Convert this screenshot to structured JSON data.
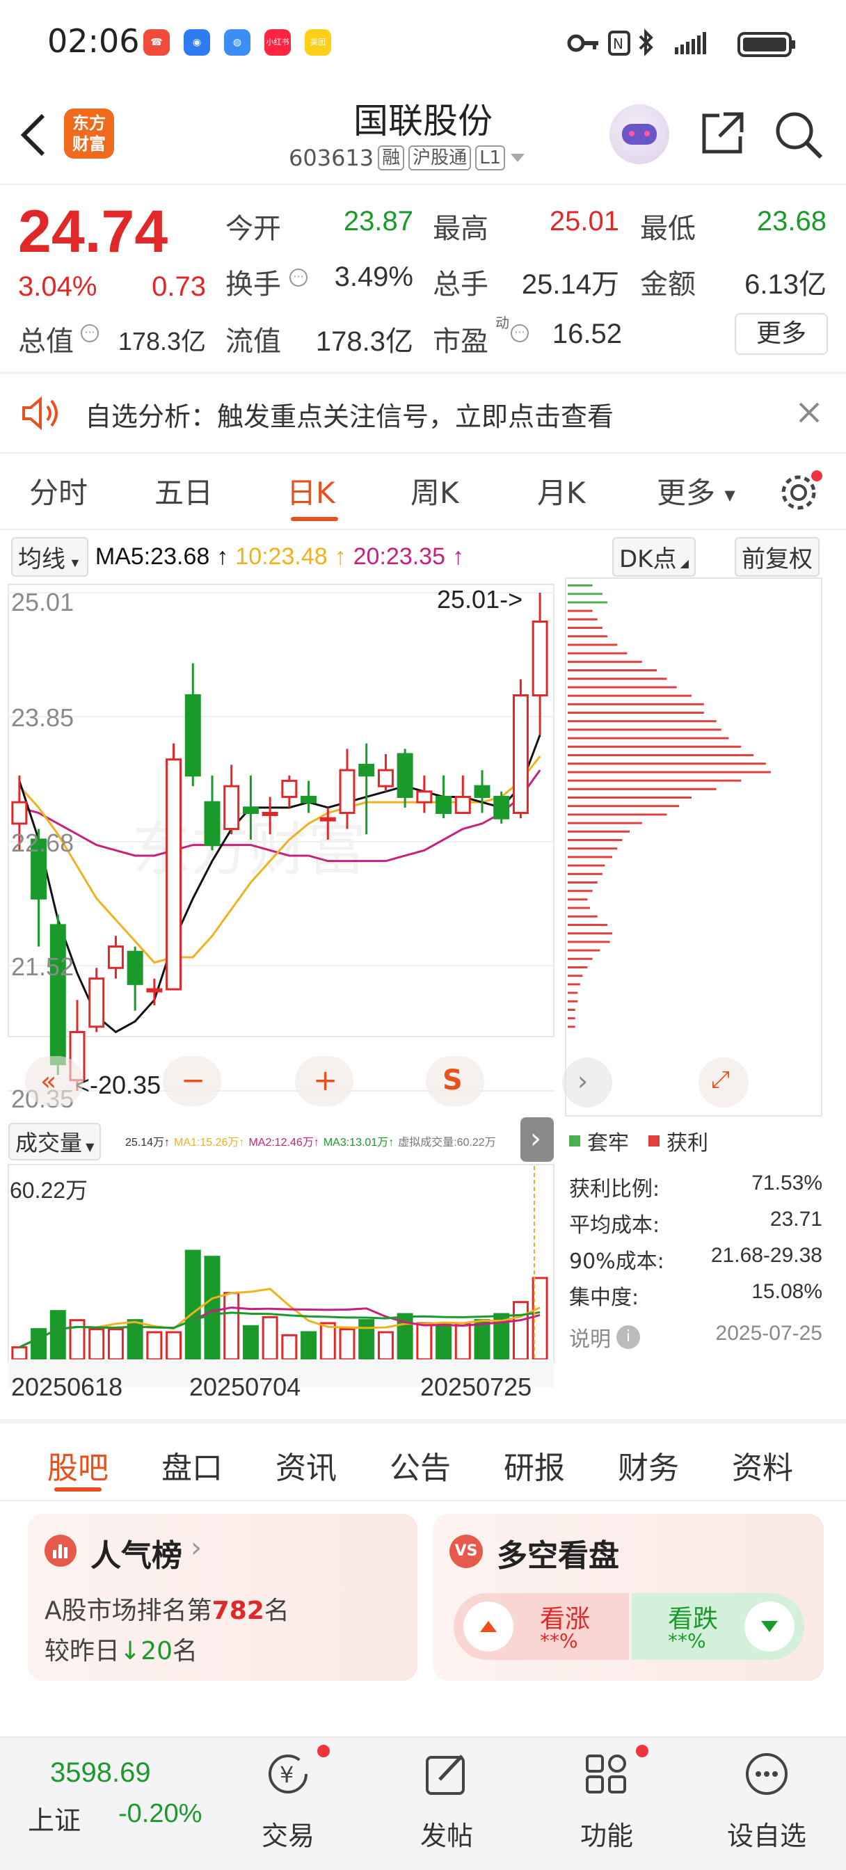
{
  "status_bar": {
    "time": "02:06",
    "apps": [
      {
        "name": "phone-app",
        "color": "#f04a3a",
        "label": "☎"
      },
      {
        "name": "browser-app",
        "color": "#2f7cf2",
        "label": "◉"
      },
      {
        "name": "globe-app",
        "color": "#3c8df5",
        "label": "◍"
      },
      {
        "name": "xiaohongshu-app",
        "color": "#ff2442",
        "label": "小红书"
      },
      {
        "name": "meituan-app",
        "color": "#ffcf1a",
        "label": "美团"
      }
    ],
    "battery_icon": "battery-icon"
  },
  "nav": {
    "logo_line1": "东方",
    "logo_line2": "财富",
    "stock_name": "国联股份",
    "stock_code": "603613",
    "tag_margin": "融",
    "tag_connect": "沪股通",
    "tag_level": "L1"
  },
  "quote": {
    "price": "24.74",
    "change_pct": "3.04%",
    "change_amt": "0.73",
    "open_label": "今开",
    "open": "23.87",
    "high_label": "最高",
    "high": "25.01",
    "low_label": "最低",
    "low": "23.68",
    "turnover_label": "换手",
    "turnover": "3.49%",
    "volume_label": "总手",
    "volume": "25.14万",
    "amount_label": "金额",
    "amount": "6.13亿",
    "mktcap_label": "总值",
    "mktcap": "178.3亿",
    "float_label": "流值",
    "float": "178.3亿",
    "pe_label": "市盈",
    "pe_sup": "动",
    "pe": "16.52",
    "more_button": "更多"
  },
  "alert": {
    "text": "自选分析：触发重点关注信号，立即点击查看"
  },
  "kline_tabs": [
    "分时",
    "五日",
    "日K",
    "周K",
    "月K",
    "更多"
  ],
  "kline_active": "日K",
  "ma_row": {
    "select_label": "均线",
    "ma5": "MA5:23.68",
    "ma10": "10:23.48",
    "ma20": "20:23.35",
    "dk_button": "DK点",
    "adjust_button": "前复权",
    "colors": {
      "ma5": "#111111",
      "ma10": "#f0b21c",
      "ma20": "#c8207c"
    }
  },
  "chart_data": {
    "type": "candlestick",
    "y_ticks": [
      "25.01",
      "23.85",
      "22.68",
      "21.52",
      "20.35"
    ],
    "ylim": [
      20.35,
      25.01
    ],
    "max_label": "25.01->",
    "min_label": "<-20.35",
    "x_labels": [
      "20250618",
      "20250704",
      "20250725"
    ],
    "watermark": "东方财富",
    "candles": [
      {
        "o": 22.85,
        "c": 23.05,
        "h": 23.3,
        "l": 22.6
      },
      {
        "o": 22.7,
        "c": 22.15,
        "h": 22.8,
        "l": 21.7
      },
      {
        "o": 21.9,
        "c": 20.6,
        "h": 22.0,
        "l": 20.5
      },
      {
        "o": 20.45,
        "c": 20.9,
        "h": 21.2,
        "l": 20.35
      },
      {
        "o": 20.95,
        "c": 21.4,
        "h": 21.5,
        "l": 20.9
      },
      {
        "o": 21.5,
        "c": 21.7,
        "h": 21.8,
        "l": 21.4
      },
      {
        "o": 21.65,
        "c": 21.35,
        "h": 21.7,
        "l": 21.1
      },
      {
        "o": 21.3,
        "c": 21.3,
        "h": 21.4,
        "l": 21.15
      },
      {
        "o": 21.3,
        "c": 23.45,
        "h": 23.6,
        "l": 21.3
      },
      {
        "o": 24.05,
        "c": 23.3,
        "h": 24.35,
        "l": 23.2
      },
      {
        "o": 23.05,
        "c": 22.65,
        "h": 23.3,
        "l": 22.6
      },
      {
        "o": 22.8,
        "c": 23.2,
        "h": 23.4,
        "l": 22.75
      },
      {
        "o": 23.0,
        "c": 22.95,
        "h": 23.3,
        "l": 22.7
      },
      {
        "o": 22.95,
        "c": 22.95,
        "h": 23.1,
        "l": 22.75
      },
      {
        "o": 23.1,
        "c": 23.25,
        "h": 23.3,
        "l": 23.0
      },
      {
        "o": 23.1,
        "c": 23.05,
        "h": 23.25,
        "l": 22.95
      },
      {
        "o": 22.9,
        "c": 22.9,
        "h": 23.0,
        "l": 22.7
      },
      {
        "o": 22.95,
        "c": 23.35,
        "h": 23.55,
        "l": 22.8
      },
      {
        "o": 23.4,
        "c": 23.3,
        "h": 23.6,
        "l": 22.75
      },
      {
        "o": 23.2,
        "c": 23.35,
        "h": 23.5,
        "l": 23.15
      },
      {
        "o": 23.5,
        "c": 23.1,
        "h": 23.55,
        "l": 23.0
      },
      {
        "o": 23.05,
        "c": 23.15,
        "h": 23.3,
        "l": 22.95
      },
      {
        "o": 23.1,
        "c": 22.95,
        "h": 23.3,
        "l": 22.9
      },
      {
        "o": 22.95,
        "c": 23.1,
        "h": 23.3,
        "l": 22.95
      },
      {
        "o": 23.2,
        "c": 23.1,
        "h": 23.35,
        "l": 22.95
      },
      {
        "o": 23.1,
        "c": 22.9,
        "h": 23.15,
        "l": 22.85
      },
      {
        "o": 22.95,
        "c": 24.05,
        "h": 24.2,
        "l": 22.9
      },
      {
        "o": 24.05,
        "c": 24.74,
        "h": 25.01,
        "l": 23.68
      }
    ],
    "ma5": [
      23.25,
      22.7,
      21.95,
      21.45,
      21.05,
      20.9,
      21.0,
      21.2,
      21.75,
      22.15,
      22.5,
      22.8,
      23.0,
      23.0,
      23.0,
      23.05,
      23.0,
      23.05,
      23.1,
      23.15,
      23.2,
      23.15,
      23.1,
      23.1,
      23.05,
      23.0,
      23.2,
      23.68
    ],
    "ma10": [
      23.2,
      23.0,
      22.75,
      22.45,
      22.15,
      21.95,
      21.75,
      21.55,
      21.6,
      21.6,
      21.8,
      22.05,
      22.3,
      22.5,
      22.7,
      22.85,
      22.95,
      23.0,
      23.05,
      23.05,
      23.05,
      23.05,
      23.05,
      23.05,
      23.05,
      23.1,
      23.25,
      23.48
    ],
    "ma20": [
      23.0,
      22.95,
      22.85,
      22.75,
      22.65,
      22.6,
      22.55,
      22.55,
      22.6,
      22.65,
      22.65,
      22.65,
      22.65,
      22.6,
      22.55,
      22.55,
      22.5,
      22.5,
      22.5,
      22.5,
      22.55,
      22.6,
      22.7,
      22.8,
      22.85,
      22.95,
      23.1,
      23.35
    ]
  },
  "volume_data": {
    "select_label": "成交量",
    "max_label": "60.22万",
    "legend": [
      {
        "text": "25.14万",
        "color": "#333333"
      },
      {
        "text": "MA1:15.26万",
        "color": "#f0b21c"
      },
      {
        "text": "MA2:12.46万",
        "color": "#c8207c"
      },
      {
        "text": "MA3:13.01万",
        "color": "#1a9a2a"
      },
      {
        "text": "虚拟成交量:60.22万",
        "color": "#777777"
      }
    ],
    "values": [
      4,
      10,
      16,
      13,
      10,
      10,
      13,
      9,
      9,
      36,
      34,
      22,
      11,
      14,
      8,
      9,
      12,
      10,
      13,
      9,
      15,
      12,
      12,
      12,
      13,
      15,
      19,
      27
    ]
  },
  "chips": {
    "legend_hold": "套牢",
    "legend_profit": "获利",
    "profit_ratio_label": "获利比例:",
    "profit_ratio": "71.53%",
    "avg_cost_label": "平均成本:",
    "avg_cost": "23.71",
    "cost90_label": "90%成本:",
    "cost90": "21.68-29.38",
    "concentration_label": "集中度:",
    "concentration": "15.08%",
    "note_label": "说明",
    "date": "2025-07-25",
    "bars_red": [
      0.1,
      0.12,
      0.14,
      0.16,
      0.2,
      0.24,
      0.3,
      0.36,
      0.4,
      0.44,
      0.5,
      0.55,
      0.55,
      0.6,
      0.62,
      0.65,
      0.7,
      0.75,
      0.8,
      0.82,
      0.7,
      0.6,
      0.5,
      0.45,
      0.4,
      0.3,
      0.25,
      0.22,
      0.2,
      0.18,
      0.15,
      0.14,
      0.12,
      0.1,
      0.08,
      0.09,
      0.12,
      0.16,
      0.18,
      0.17,
      0.13,
      0.1,
      0.08,
      0.06,
      0.05,
      0.04,
      0.04,
      0.03,
      0.03,
      0.03
    ],
    "bars_green": [
      0.1,
      0.14,
      0.16
    ]
  },
  "section_tabs": [
    "股吧",
    "盘口",
    "资讯",
    "公告",
    "研报",
    "财务",
    "资料"
  ],
  "section_active": "股吧",
  "popularity": {
    "title": "人气榜",
    "rank_prefix": "A股市场排名第",
    "rank": "782",
    "rank_suffix": "名",
    "change_prefix": "较昨日",
    "change": "20",
    "change_suffix": "名"
  },
  "sentiment": {
    "title": "多空看盘",
    "up_label": "看涨",
    "up_value": "**%",
    "down_label": "看跌",
    "down_value": "**%"
  },
  "bottom_bar": {
    "index_value": "3598.69",
    "index_name": "上证",
    "index_change": "-0.20%",
    "items": [
      "交易",
      "发帖",
      "功能",
      "设自选"
    ]
  }
}
